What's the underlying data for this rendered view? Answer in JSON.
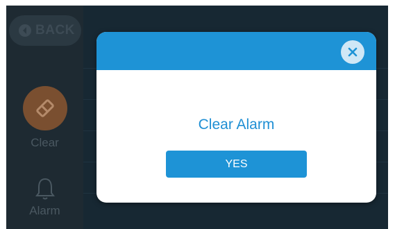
{
  "sidebar": {
    "back_label": "BACK",
    "items": [
      {
        "label": "Clear",
        "icon": "eraser-icon"
      },
      {
        "label": "Alarm",
        "icon": "bell-icon"
      }
    ]
  },
  "dialog": {
    "message": "Clear Alarm",
    "confirm_label": "YES",
    "close_icon": "close-icon"
  },
  "colors": {
    "accent": "#1e93d6",
    "clear_circle": "#7a4f30",
    "background": "#172833"
  }
}
